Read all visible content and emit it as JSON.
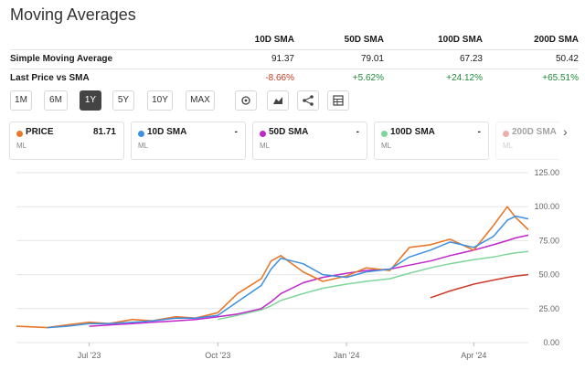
{
  "page": {
    "title": "Moving Averages"
  },
  "sma_table": {
    "headers": [
      "10D SMA",
      "50D SMA",
      "100D SMA",
      "200D SMA"
    ],
    "rows": [
      {
        "label": "Simple Moving Average",
        "values": [
          "91.37",
          "79.01",
          "67.23",
          "50.42"
        ]
      },
      {
        "label": "Last Price vs SMA",
        "values": [
          "-8.66%",
          "+5.62%",
          "+24.12%",
          "+65.51%"
        ]
      }
    ]
  },
  "ranges": [
    "1M",
    "6M",
    "1Y",
    "5Y",
    "10Y",
    "MAX"
  ],
  "active_range": "1Y",
  "tools": [
    "settings-icon",
    "chart-type-icon",
    "share-icon",
    "table-icon"
  ],
  "series_cards": [
    {
      "name": "PRICE",
      "value": "81.71",
      "sub": "ML",
      "color": "#e8782b"
    },
    {
      "name": "10D SMA",
      "value": "-",
      "sub": "ML",
      "color": "#3d8fe0"
    },
    {
      "name": "50D SMA",
      "value": "-",
      "sub": "ML",
      "color": "#c026c9"
    },
    {
      "name": "100D SMA",
      "value": "-",
      "sub": "ML",
      "color": "#7fd69a"
    },
    {
      "name": "200D SMA",
      "value": "",
      "sub": "ML",
      "color": "#cc3a2a"
    }
  ],
  "chart_data": {
    "type": "line",
    "ylim": [
      0,
      125
    ],
    "yticks": [
      "125.00",
      "100.00",
      "75.00",
      "50.00",
      "25.00",
      "0.00"
    ],
    "xticks": [
      "Jul '23",
      "Oct '23",
      "Jan '24",
      "Apr '24"
    ],
    "x": [
      "2023-05-10",
      "2023-06-01",
      "2023-06-15",
      "2023-07-01",
      "2023-07-15",
      "2023-08-01",
      "2023-08-15",
      "2023-09-01",
      "2023-09-15",
      "2023-10-01",
      "2023-10-15",
      "2023-11-01",
      "2023-11-08",
      "2023-11-15",
      "2023-12-01",
      "2023-12-15",
      "2024-01-01",
      "2024-01-15",
      "2024-02-01",
      "2024-02-15",
      "2024-03-01",
      "2024-03-15",
      "2024-04-01",
      "2024-04-15",
      "2024-04-25",
      "2024-05-01",
      "2024-05-10"
    ],
    "series": [
      {
        "name": "PRICE",
        "color": "#e8782b",
        "values": [
          12,
          11,
          13,
          15,
          14,
          17,
          16,
          19,
          18,
          22,
          36,
          47,
          60,
          64,
          52,
          45,
          49,
          55,
          53,
          70,
          72,
          76,
          68,
          86,
          100,
          92,
          83
        ]
      },
      {
        "name": "10D SMA",
        "color": "#3d8fe0",
        "values": [
          null,
          11,
          12,
          14,
          14,
          15,
          16,
          18,
          18,
          20,
          30,
          42,
          54,
          62,
          58,
          50,
          48,
          52,
          54,
          63,
          68,
          74,
          70,
          78,
          90,
          93,
          91
        ]
      },
      {
        "name": "50D SMA",
        "color": "#c026c9",
        "values": [
          null,
          null,
          null,
          12,
          13,
          14,
          15,
          16,
          17,
          19,
          21,
          25,
          30,
          36,
          44,
          48,
          51,
          53,
          54,
          57,
          60,
          64,
          68,
          72,
          75,
          77,
          79
        ]
      },
      {
        "name": "100D SMA",
        "color": "#7fd69a",
        "values": [
          null,
          null,
          null,
          null,
          null,
          null,
          null,
          null,
          null,
          17,
          20,
          24,
          27,
          31,
          36,
          40,
          43,
          45,
          47,
          51,
          55,
          58,
          61,
          63,
          65,
          66,
          67
        ]
      },
      {
        "name": "200D SMA",
        "color": "#cc3a2a",
        "values": [
          null,
          null,
          null,
          null,
          null,
          null,
          null,
          null,
          null,
          null,
          null,
          null,
          null,
          null,
          null,
          null,
          null,
          null,
          null,
          null,
          33,
          38,
          43,
          46,
          48,
          49,
          50
        ]
      }
    ]
  }
}
